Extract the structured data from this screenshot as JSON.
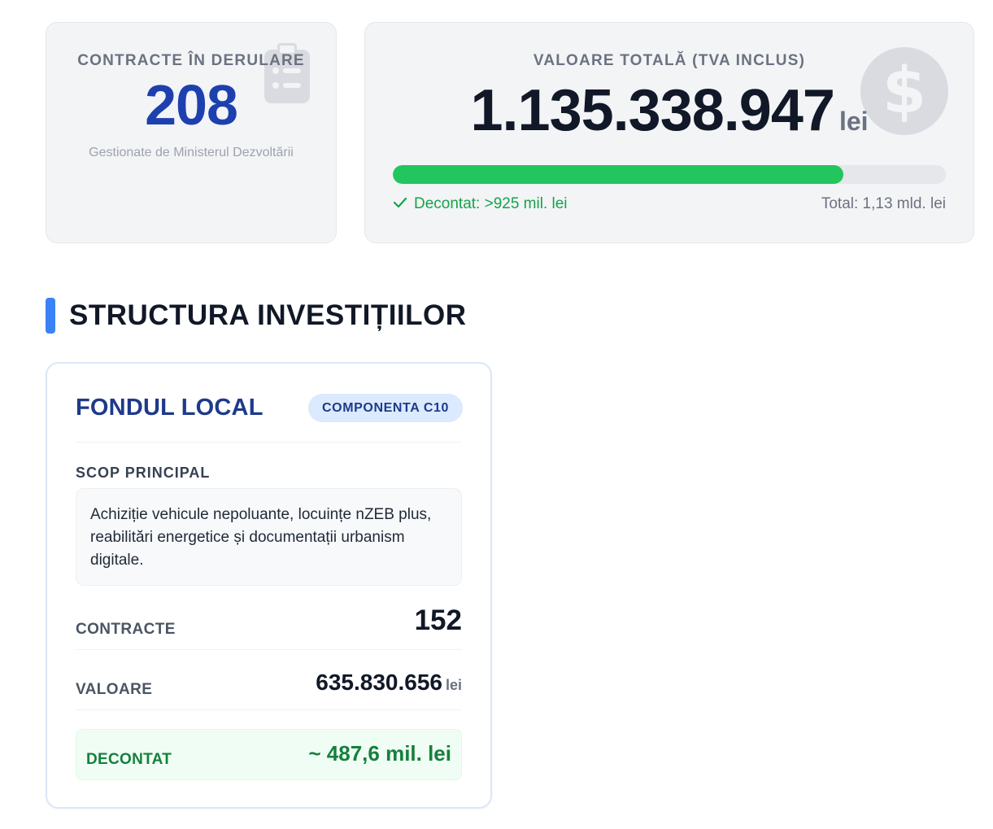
{
  "summary_cards": {
    "contracts": {
      "label": "CONTRACTE ÎN DERULARE",
      "value": "208",
      "note": "Gestionate de Ministerul Dezvoltării",
      "icon": "clipboard-icon"
    },
    "total_value": {
      "label": "VALOARE TOTALĂ (TVA INCLUS)",
      "amount": "1.135.338.947",
      "unit": "lei",
      "icon": "dollar-icon",
      "progress_fraction": 0.815,
      "settled_note": "Decontat: >925 mil. lei",
      "total_note": "Total: 1,13 mld. lei"
    }
  },
  "section": {
    "title": "STRUCTURA INVESTIȚIILOR",
    "accent_color": "#3b82f6"
  },
  "fund": {
    "title": "FONDUL LOCAL",
    "badge": "COMPONENTA C10",
    "scope_label": "SCOP PRINCIPAL",
    "scope_text": "Achiziție vehicule nepoluante, locuințe nZEB plus, reabilitări energetice și documentații urbanism digitale.",
    "contracts_label": "CONTRACTE",
    "contracts_value": "152",
    "value_label": "VALOARE",
    "value_amount": "635.830.656",
    "value_unit": "lei",
    "settled_label": "DECONTAT",
    "settled_value": "~ 487,6 mil. lei"
  },
  "colors": {
    "primary_blue": "#1e40af",
    "success_green": "#22c55e",
    "muted_gray": "#6b7280"
  }
}
